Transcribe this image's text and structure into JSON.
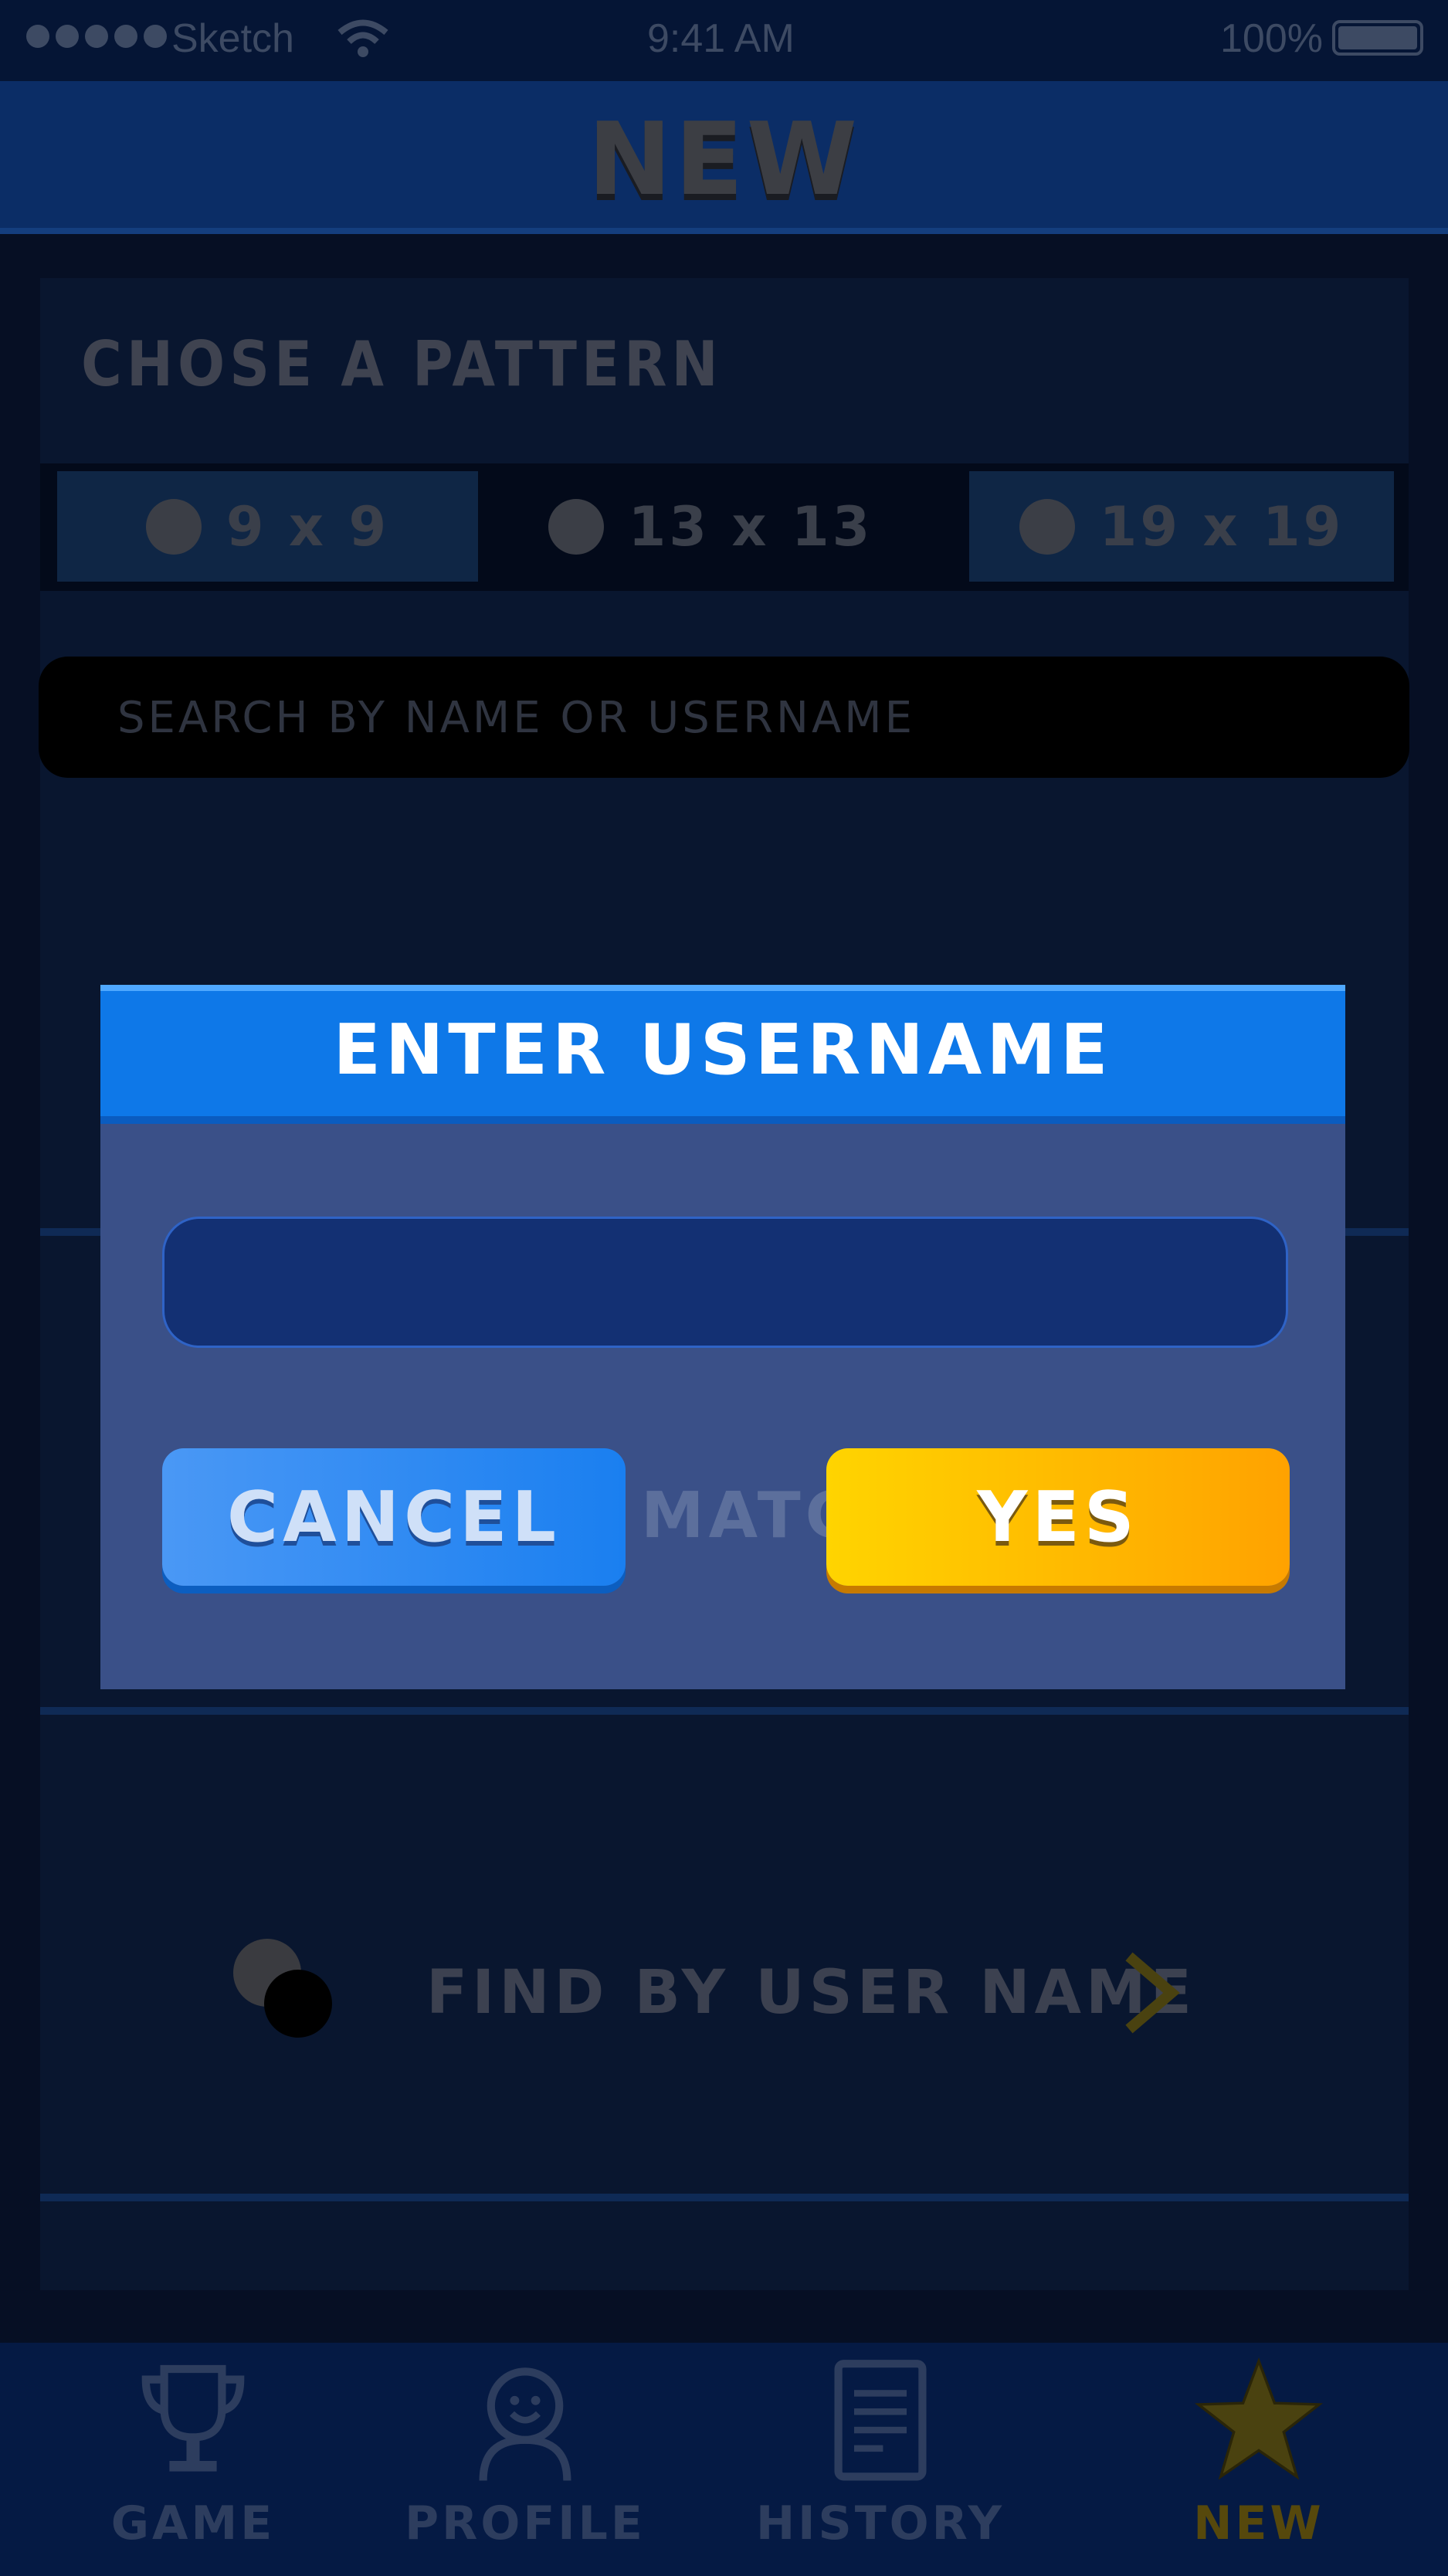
{
  "status_bar": {
    "carrier": "Sketch",
    "time": "9:41 AM",
    "battery": "100%"
  },
  "header": {
    "title": "NEW"
  },
  "pattern_section": {
    "title": "CHOSE A PATTERN",
    "options": [
      {
        "label": "9 x 9"
      },
      {
        "label": "13 x 13"
      },
      {
        "label": "19 x 19"
      }
    ]
  },
  "search": {
    "placeholder": "SEARCH BY NAME OR USERNAME"
  },
  "find": {
    "label": "FIND BY USER NAME"
  },
  "dialog": {
    "title": "ENTER USERNAME",
    "input_value": "",
    "behind_text": "MATCH",
    "cancel_label": "CANCEL",
    "yes_label": "YES"
  },
  "tabs": [
    {
      "label": "GAME",
      "icon": "trophy-icon"
    },
    {
      "label": "PROFILE",
      "icon": "profile-icon"
    },
    {
      "label": "HISTORY",
      "icon": "history-icon"
    },
    {
      "label": "NEW",
      "icon": "star-icon"
    }
  ],
  "colors": {
    "dialog_header": "#0e78e8",
    "yes_button": "#ffb400",
    "cancel_button": "#1a7ff0"
  }
}
